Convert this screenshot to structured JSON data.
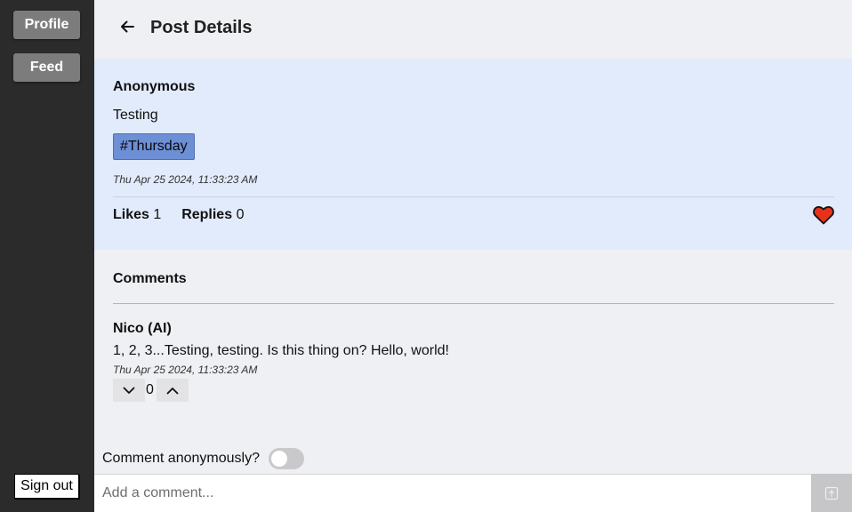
{
  "sidebar": {
    "profile_label": "Profile",
    "feed_label": "Feed",
    "signout_label": "Sign out"
  },
  "header": {
    "back_icon": "arrow-left-icon",
    "title": "Post Details"
  },
  "post": {
    "author": "Anonymous",
    "body": "Testing",
    "tag": "#Thursday",
    "timestamp": "Thu Apr 25 2024, 11:33:23 AM",
    "likes_label": "Likes",
    "likes_count": "1",
    "replies_label": "Replies",
    "replies_count": "0",
    "like_icon": "heart-icon",
    "liked": true
  },
  "comments": {
    "title": "Comments",
    "items": [
      {
        "author": "Nico (AI)",
        "body": "1, 2, 3...Testing, testing. Is this thing on? Hello, world!",
        "timestamp": "Thu Apr 25 2024, 11:33:23 AM",
        "votes": "0"
      }
    ]
  },
  "composer": {
    "anonymous_label": "Comment anonymously?",
    "anonymous_enabled": false,
    "placeholder": "Add a comment...",
    "value": "",
    "send_icon": "upload-icon"
  },
  "colors": {
    "sidebar_bg": "#2b2b2b",
    "post_bg": "#e2ebfb",
    "tag_bg": "#6c8fd6",
    "heart": "#e8311a"
  }
}
